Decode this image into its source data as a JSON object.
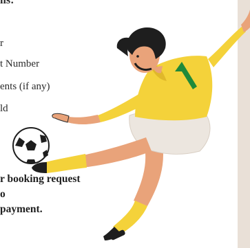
{
  "heading_fragment": "ils:",
  "details_list": [
    "r",
    "t Number",
    "ents (if any)",
    "ld"
  ],
  "note_lines": [
    "r booking request",
    "o",
    "payment."
  ],
  "colors": {
    "background": "#ffffff",
    "side_panel": "#e9e0d7",
    "jersey": "#f4d23a",
    "jersey_stripe": "#1f8a3a",
    "shorts": "#ece6df",
    "skin": "#e9a37a",
    "hair": "#1e1e1e",
    "socks": "#f4d23a"
  },
  "illustration": "soccer-player-kicking-ball"
}
